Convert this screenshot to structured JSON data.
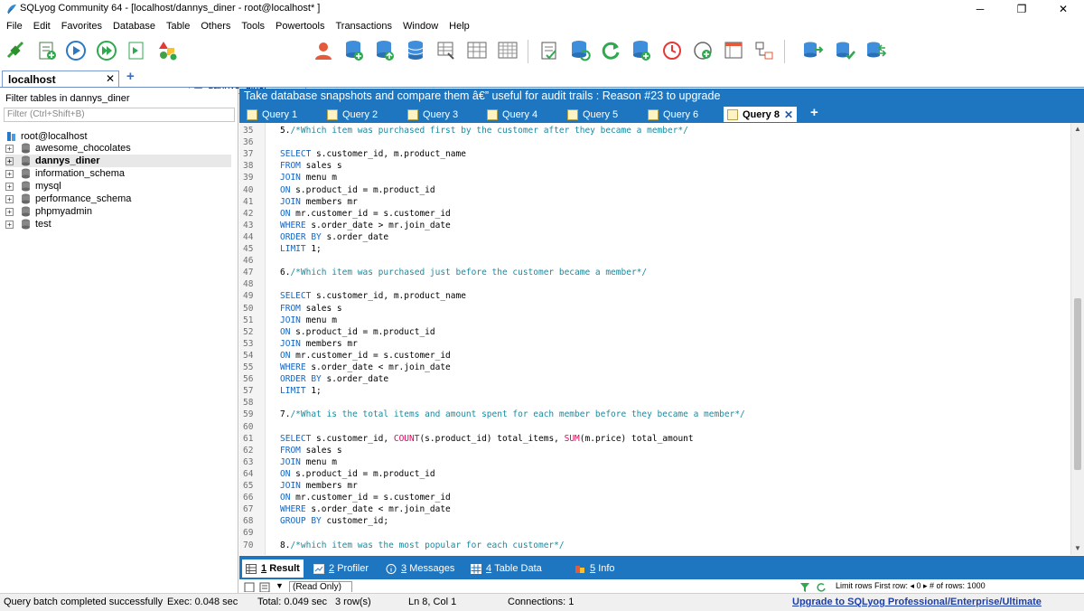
{
  "window": {
    "title": "SQLyog Community 64 - [localhost/dannys_diner - root@localhost* ]",
    "minimize": "─",
    "restore": "❐",
    "close": "✕"
  },
  "menu": [
    "File",
    "Edit",
    "Favorites",
    "Database",
    "Table",
    "Others",
    "Tools",
    "Powertools",
    "Transactions",
    "Window",
    "Help"
  ],
  "toolbar": {
    "database_select": "dannys_diner"
  },
  "connection_tabs": {
    "active": "localhost",
    "close": "✕",
    "add": "+"
  },
  "object_browser": {
    "filter_label": "Filter tables in dannys_diner",
    "filter_placeholder": "Filter (Ctrl+Shift+B)",
    "root": "root@localhost",
    "databases": [
      "awesome_chocolates",
      "dannys_diner",
      "information_schema",
      "mysql",
      "performance_schema",
      "phpmyadmin",
      "test"
    ],
    "active_database": "dannys_diner",
    "expander": "+"
  },
  "banner": "Take database snapshots and compare them â€” useful for audit trails : Reason #23 to upgrade",
  "query_tabs": {
    "tabs": [
      "Query 1",
      "Query 2",
      "Query 3",
      "Query 4",
      "Query 5",
      "Query 6",
      "Query 8"
    ],
    "active": "Query 8",
    "close": "✕",
    "add": "+"
  },
  "editor": {
    "lines": [
      {
        "n": "35",
        "t": "5./*Which item was purchased first by the customer after they became a member*/"
      },
      {
        "n": "36",
        "t": ""
      },
      {
        "n": "37",
        "t": "SELECT s.customer_id, m.product_name"
      },
      {
        "n": "38",
        "t": "FROM sales s"
      },
      {
        "n": "39",
        "t": "JOIN menu m"
      },
      {
        "n": "40",
        "t": "ON s.product_id = m.product_id"
      },
      {
        "n": "41",
        "t": "JOIN members mr"
      },
      {
        "n": "42",
        "t": "ON mr.customer_id = s.customer_id"
      },
      {
        "n": "43",
        "t": "WHERE s.order_date > mr.join_date"
      },
      {
        "n": "44",
        "t": "ORDER BY s.order_date"
      },
      {
        "n": "45",
        "t": "LIMIT 1;"
      },
      {
        "n": "46",
        "t": ""
      },
      {
        "n": "47",
        "t": "6./*Which item was purchased just before the customer became a member*/"
      },
      {
        "n": "48",
        "t": ""
      },
      {
        "n": "49",
        "t": "SELECT s.customer_id, m.product_name"
      },
      {
        "n": "50",
        "t": "FROM sales s"
      },
      {
        "n": "51",
        "t": "JOIN menu m"
      },
      {
        "n": "52",
        "t": "ON s.product_id = m.product_id"
      },
      {
        "n": "53",
        "t": "JOIN members mr"
      },
      {
        "n": "54",
        "t": "ON mr.customer_id = s.customer_id"
      },
      {
        "n": "55",
        "t": "WHERE s.order_date < mr.join_date"
      },
      {
        "n": "56",
        "t": "ORDER BY s.order_date"
      },
      {
        "n": "57",
        "t": "LIMIT 1;"
      },
      {
        "n": "58",
        "t": ""
      },
      {
        "n": "59",
        "t": "7./*What is the total items and amount spent for each member before they became a member*/"
      },
      {
        "n": "60",
        "t": ""
      },
      {
        "n": "61",
        "t": "SELECT s.customer_id, COUNT(s.product_id) total_items, SUM(m.price) total_amount"
      },
      {
        "n": "62",
        "t": "FROM sales s"
      },
      {
        "n": "63",
        "t": "JOIN menu m"
      },
      {
        "n": "64",
        "t": "ON s.product_id = m.product_id"
      },
      {
        "n": "65",
        "t": "JOIN members mr"
      },
      {
        "n": "66",
        "t": "ON mr.customer_id = s.customer_id"
      },
      {
        "n": "67",
        "t": "WHERE s.order_date < mr.join_date"
      },
      {
        "n": "68",
        "t": "GROUP BY customer_id;"
      },
      {
        "n": "69",
        "t": ""
      },
      {
        "n": "70",
        "t": "8./*which item was the most popular for each customer*/"
      }
    ]
  },
  "result_tabs": [
    {
      "num": "1",
      "label": "Result"
    },
    {
      "num": "2",
      "label": "Profiler"
    },
    {
      "num": "3",
      "label": "Messages"
    },
    {
      "num": "4",
      "label": "Table Data"
    },
    {
      "num": "5",
      "label": "Info"
    }
  ],
  "result_toolbar": {
    "mode": "(Read Only)",
    "limit_text": "Limit rows   First row:  ◂   0                ▸   # of rows:  1000"
  },
  "status": {
    "message": "Query batch completed successfully",
    "exec": "Exec: 0.048 sec",
    "total": "Total: 0.049 sec",
    "rows": "3 row(s)",
    "position": "Ln 8, Col 1",
    "connections": "Connections: 1",
    "upgrade": "Upgrade to SQLyog Professional/Enterprise/Ultimate"
  },
  "colors": {
    "accent": "#1e76c0",
    "keyword": "#1565c0",
    "comment": "#1a8aa0",
    "function": "#e0005a"
  },
  "icons": [
    "new-connection-icon",
    "new-query-icon",
    "execute-icon",
    "execute-all-icon",
    "stop-icon",
    "schema-icon",
    "user-manager-icon",
    "backup-icon",
    "restore-icon",
    "import-icon",
    "export-icon",
    "schedule-icon",
    "sync-icon",
    "refresh-icon"
  ]
}
